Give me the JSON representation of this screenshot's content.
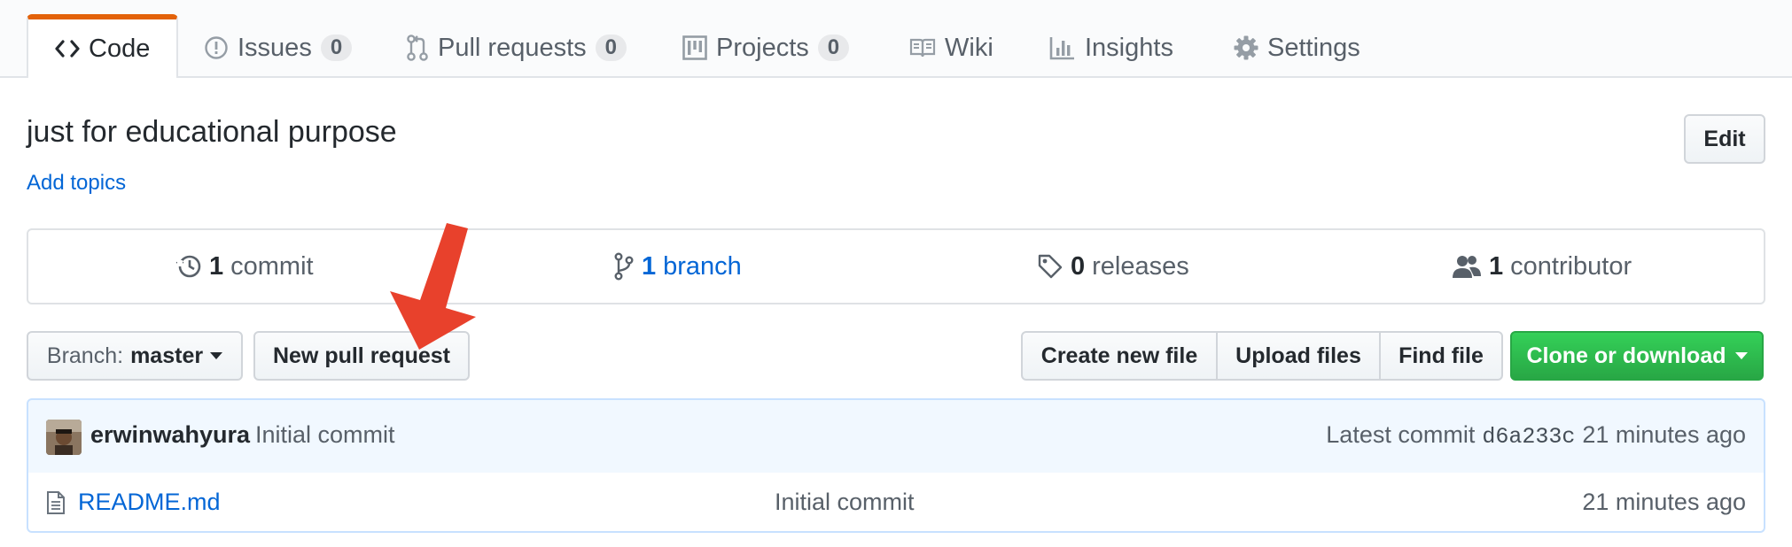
{
  "tabs": [
    {
      "label": "Code",
      "icon": "code-icon",
      "selected": true
    },
    {
      "label": "Issues",
      "icon": "issue-opened-icon",
      "count": "0"
    },
    {
      "label": "Pull requests",
      "icon": "git-pull-request-icon",
      "count": "0"
    },
    {
      "label": "Projects",
      "icon": "project-icon",
      "count": "0"
    },
    {
      "label": "Wiki",
      "icon": "book-icon"
    },
    {
      "label": "Insights",
      "icon": "graph-icon"
    },
    {
      "label": "Settings",
      "icon": "gear-icon"
    }
  ],
  "repo": {
    "description": "just for educational purpose",
    "add_topics": "Add topics",
    "edit_label": "Edit"
  },
  "summary": {
    "commits": {
      "count": "1",
      "label": "commit"
    },
    "branches": {
      "count": "1",
      "label": "branch"
    },
    "releases": {
      "count": "0",
      "label": "releases"
    },
    "contributors": {
      "count": "1",
      "label": "contributor"
    }
  },
  "file_nav": {
    "branch_prefix": "Branch:",
    "branch_name": "master",
    "new_pull_request": "New pull request",
    "create_new_file": "Create new file",
    "upload_files": "Upload files",
    "find_file": "Find file",
    "clone_or_download": "Clone or download"
  },
  "latest_commit": {
    "author": "erwinwahyura",
    "message": "Initial commit",
    "prefix": "Latest commit",
    "sha": "d6a233c",
    "age": "21 minutes ago"
  },
  "files": [
    {
      "name": "README.md",
      "message": "Initial commit",
      "age": "21 minutes ago"
    }
  ],
  "colors": {
    "accent_tab": "#e36209",
    "link": "#0366d6",
    "clone_green": "#28a745",
    "annotation_arrow": "#e8412c"
  }
}
